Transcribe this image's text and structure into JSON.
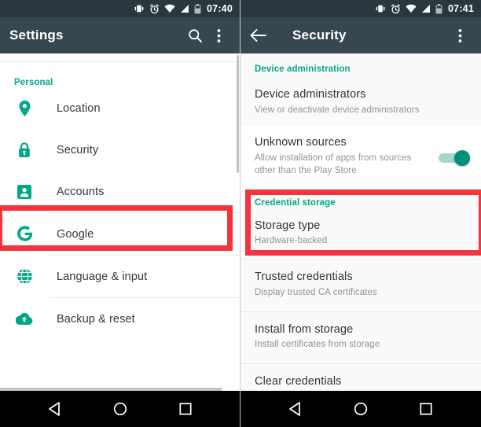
{
  "left_phone": {
    "status_bar": {
      "time": "07:40",
      "icons": [
        "vibrate-icon",
        "alarm-icon",
        "wifi-warning-icon",
        "signal-icon",
        "battery-icon"
      ]
    },
    "toolbar": {
      "title": "Settings",
      "search_icon": "search-icon",
      "overflow_icon": "more-vert-icon"
    },
    "section_label": "Personal",
    "items": [
      {
        "label": "Location",
        "icon": "location-pin-icon"
      },
      {
        "label": "Security",
        "icon": "lock-icon"
      },
      {
        "label": "Accounts",
        "icon": "account-box-icon"
      },
      {
        "label": "Google",
        "icon": "google-g-icon"
      },
      {
        "label": "Language & input",
        "icon": "globe-icon"
      },
      {
        "label": "Backup & reset",
        "icon": "cloud-upload-icon"
      }
    ],
    "highlight": "Security"
  },
  "right_phone": {
    "status_bar": {
      "time": "07:41",
      "icons": [
        "vibrate-icon",
        "alarm-icon",
        "wifi-warning-icon",
        "signal-icon",
        "battery-icon"
      ]
    },
    "toolbar": {
      "title": "Security",
      "back_icon": "arrow-back-icon",
      "overflow_icon": "more-vert-icon"
    },
    "sections": [
      {
        "header": "Device administration",
        "items": [
          {
            "title": "Device administrators",
            "subtitle": "View or deactivate device administrators",
            "toggle": null
          },
          {
            "title": "Unknown sources",
            "subtitle": "Allow installation of apps from sources other than the Play Store",
            "toggle": "on"
          }
        ]
      },
      {
        "header": "Credential storage",
        "items": [
          {
            "title": "Storage type",
            "subtitle": "Hardware-backed",
            "toggle": null
          },
          {
            "title": "Trusted credentials",
            "subtitle": "Display trusted CA certificates",
            "toggle": null
          },
          {
            "title": "Install from storage",
            "subtitle": "Install certificates from storage",
            "toggle": null
          },
          {
            "title": "Clear credentials",
            "subtitle": "",
            "toggle": null
          }
        ]
      }
    ],
    "highlight": "Unknown sources"
  },
  "nav_bar": {
    "buttons": [
      "back-triangle-icon",
      "home-circle-icon",
      "recents-square-icon"
    ]
  },
  "colors": {
    "accent_teal": "#00a884",
    "toolbar": "#37474f",
    "status_bar": "#2b373f",
    "highlight_red": "#f5333f",
    "toggle_on": "#009178"
  }
}
